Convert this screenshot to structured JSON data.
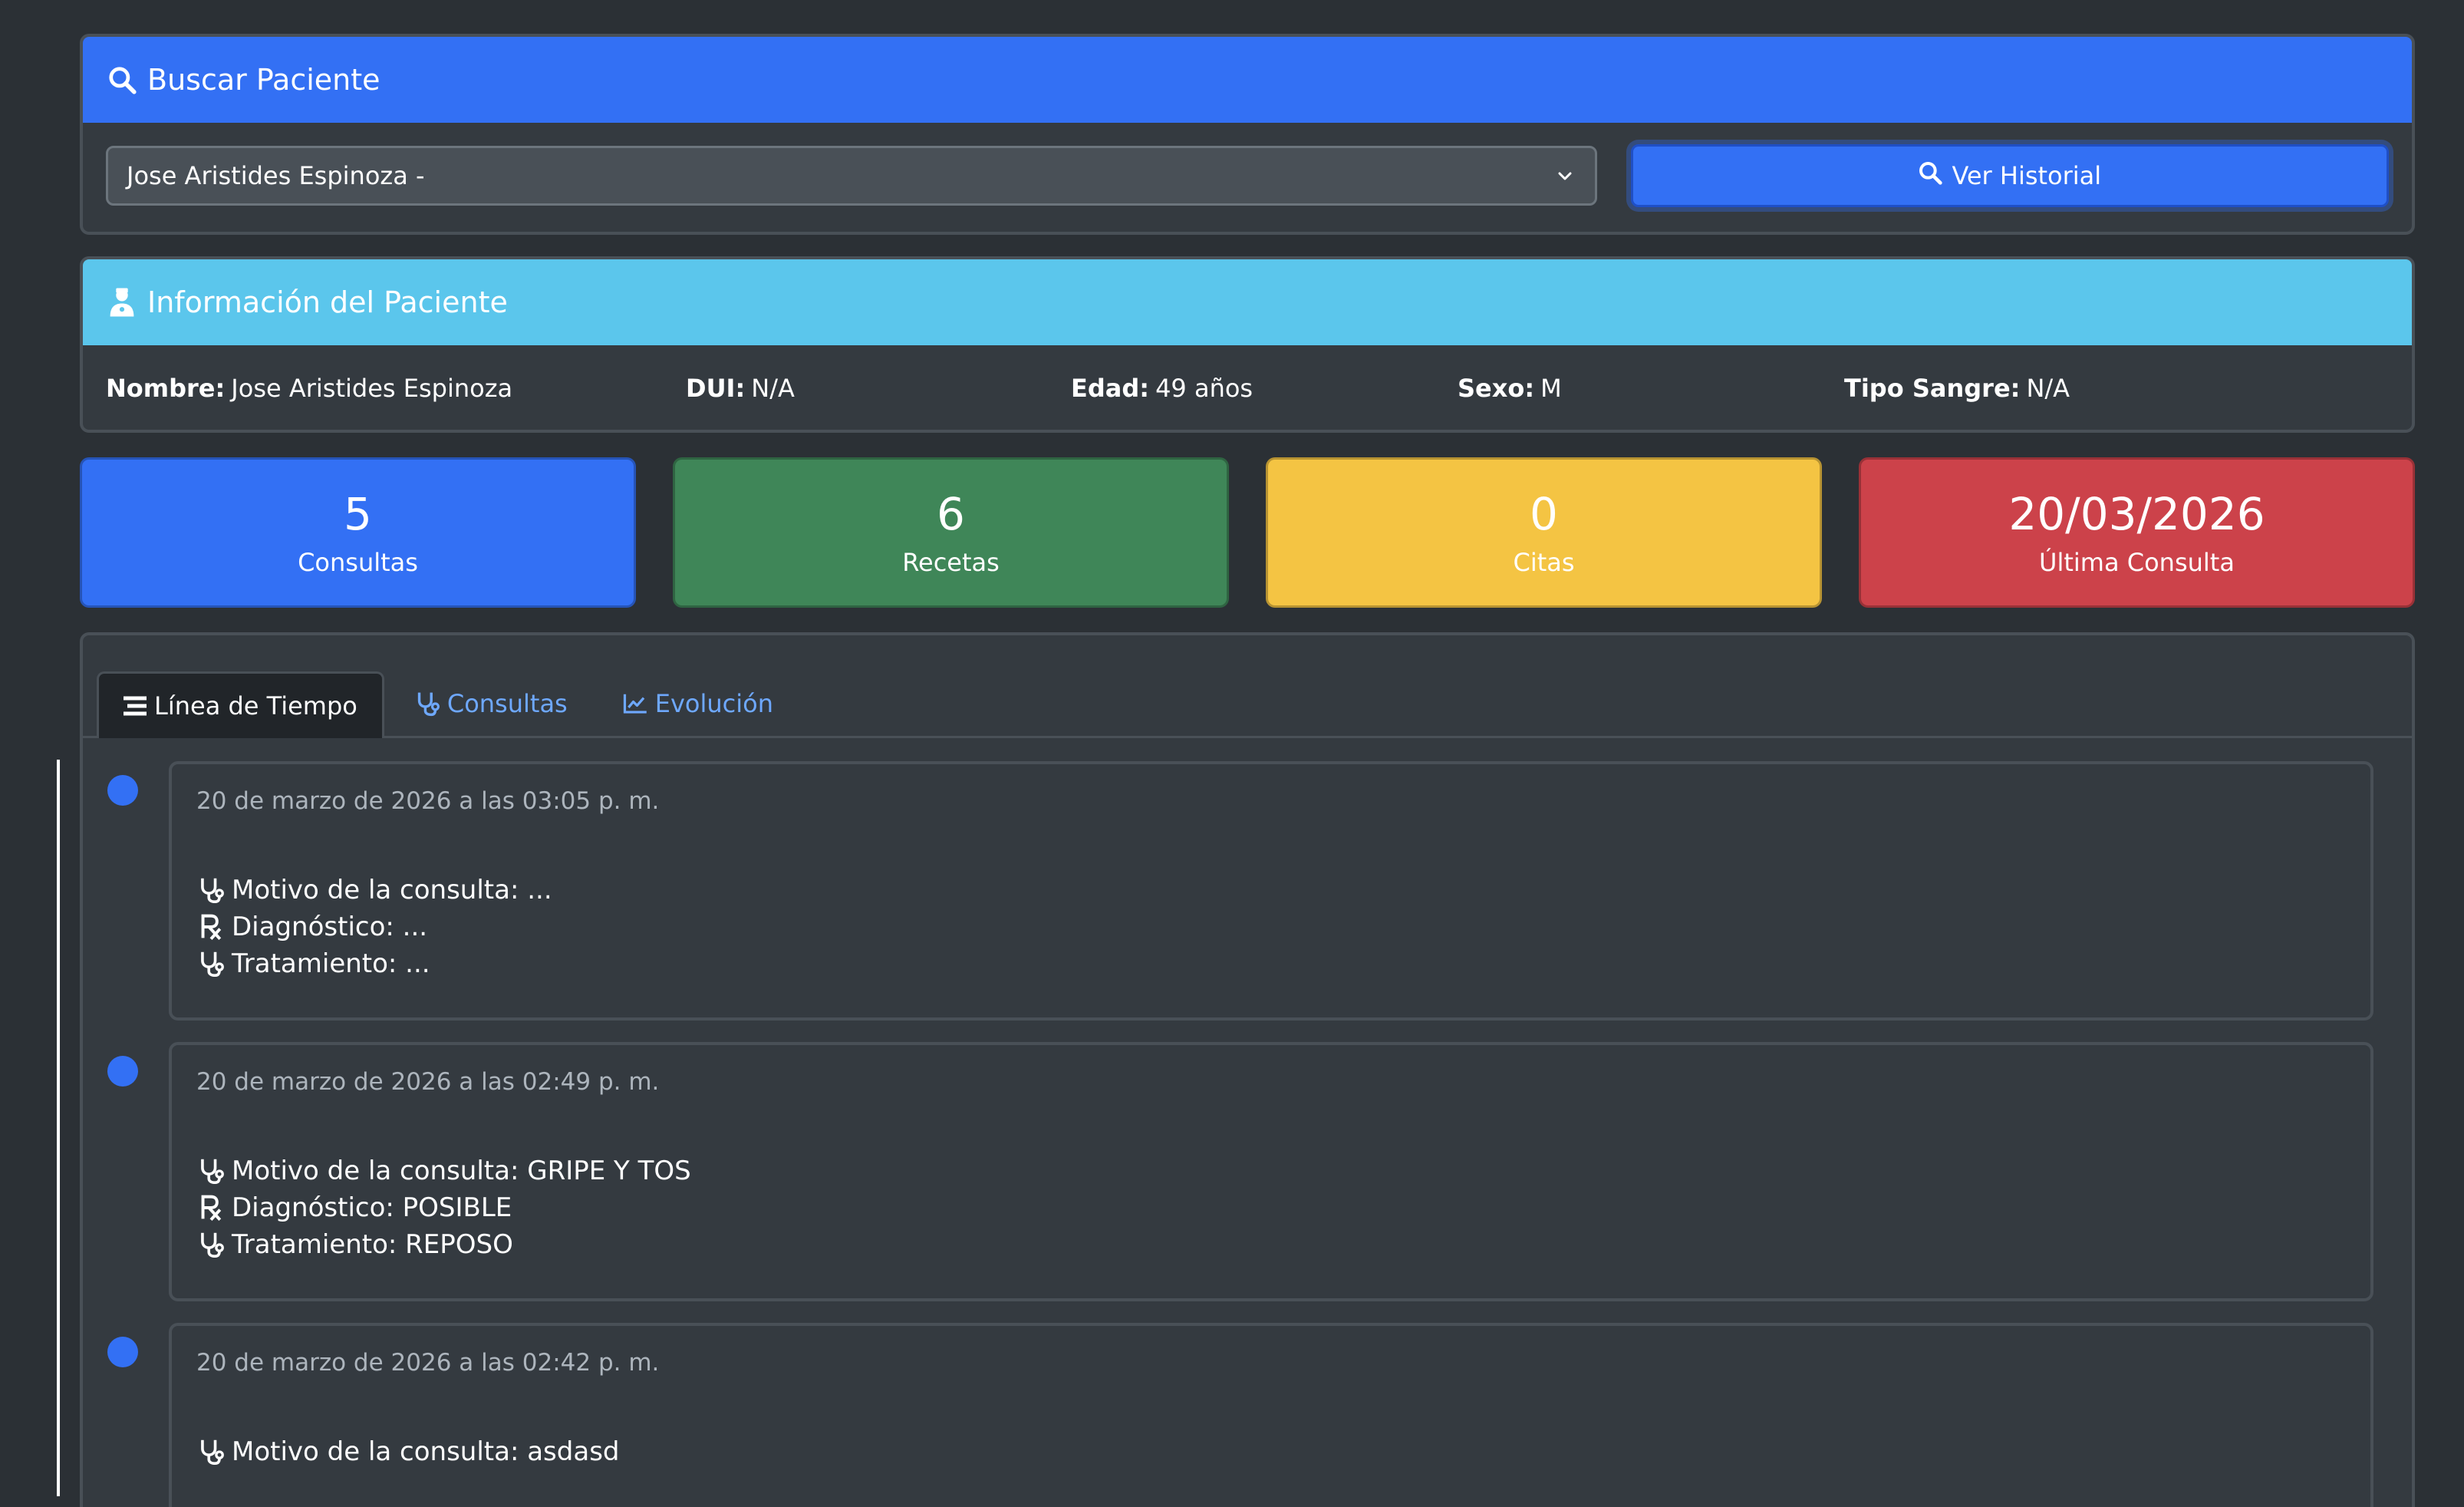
{
  "search": {
    "title": "Buscar Paciente",
    "selected_patient": "Jose Aristides Espinoza -",
    "button_label": "Ver Historial"
  },
  "patient_info": {
    "title": "Información del Paciente",
    "fields": [
      {
        "label": "Nombre:",
        "value": "Jose Aristides Espinoza"
      },
      {
        "label": "DUI:",
        "value": "N/A"
      },
      {
        "label": "Edad:",
        "value": "49 años"
      },
      {
        "label": "Sexo:",
        "value": "M"
      },
      {
        "label": "Tipo Sangre:",
        "value": "N/A"
      }
    ]
  },
  "stats": [
    {
      "value": "5",
      "label": "Consultas",
      "color": "#3370f4"
    },
    {
      "value": "6",
      "label": "Recetas",
      "color": "#3f8658"
    },
    {
      "value": "0",
      "label": "Citas",
      "color": "#f4c443"
    },
    {
      "value": "20/03/2026",
      "label": "Última Consulta",
      "color": "#cc424a"
    }
  ],
  "tabs": [
    {
      "label": "Línea de Tiempo",
      "icon": "timeline-icon",
      "active": true
    },
    {
      "label": "Consultas",
      "icon": "stethoscope-icon",
      "active": false
    },
    {
      "label": "Evolución",
      "icon": "chart-line-icon",
      "active": false
    }
  ],
  "timeline": [
    {
      "date": "20 de marzo de 2026 a las 03:05 p. m.",
      "motivo": "Motivo de la consulta: ...",
      "diagnostico": "Diagnóstico: ...",
      "tratamiento": "Tratamiento: ..."
    },
    {
      "date": "20 de marzo de 2026 a las 02:49 p. m.",
      "motivo": "Motivo de la consulta: GRIPE Y TOS",
      "diagnostico": "Diagnóstico: POSIBLE",
      "tratamiento": "Tratamiento: REPOSO"
    },
    {
      "date": "20 de marzo de 2026 a las 02:42 p. m.",
      "motivo": "Motivo de la consulta: asdasd",
      "diagnostico": "",
      "tratamiento": ""
    }
  ]
}
